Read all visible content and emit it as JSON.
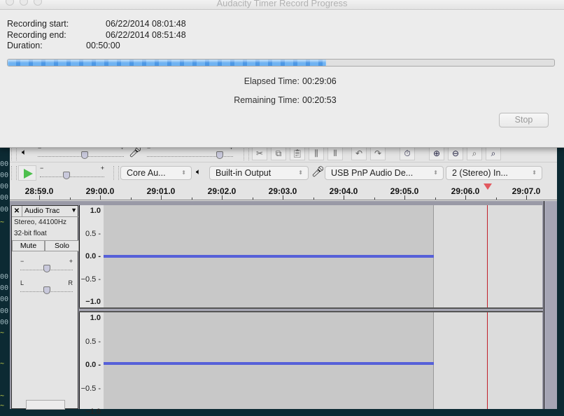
{
  "dialog": {
    "title": "Audacity Timer Record Progress",
    "recording_start_label": "Recording start:",
    "recording_start_value": "06/22/2014 08:01:48",
    "recording_end_label": "Recording end:",
    "recording_end_value": "06/22/2014 08:51:48",
    "duration_label": "Duration:",
    "duration_value": "00:50:00",
    "progress_percent": 58.2,
    "elapsed_label": "Elapsed Time:",
    "elapsed_value": "00:29:06",
    "remaining_label": "Remaining Time:",
    "remaining_value": "00:20:53",
    "stop_label": "Stop"
  },
  "toolbar": {
    "playback_volume_level": 0.55,
    "record_volume_level": 0.88,
    "play_speed_level": 0.4,
    "host_combo": "Core Au...",
    "output_combo": "Built-in Output",
    "input_combo": "USB PnP Audio De...",
    "channels_combo": "2 (Stereo) In...",
    "edit_buttons": [
      "trim-audio",
      "silence-audio",
      "cut",
      "copy",
      "paste",
      "undo",
      "redo",
      "sync-lock",
      "zoom-in",
      "zoom-out",
      "fit-selection",
      "fit-project"
    ],
    "minus": "−",
    "plus": "+"
  },
  "ruler": {
    "labels": [
      "28:59.0",
      "29:00.0",
      "29:01.0",
      "29:02.0",
      "29:03.0",
      "29:04.0",
      "29:05.0",
      "29:06.0",
      "29:07.0"
    ],
    "playhead_marker": "29:06.4"
  },
  "track": {
    "name": "Audio Trac",
    "format": "Stereo, 44100Hz",
    "bit_depth": "32-bit float",
    "mute_label": "Mute",
    "solo_label": "Solo",
    "gain_minus": "−",
    "gain_plus": "+",
    "pan_left": "L",
    "pan_right": "R",
    "gain_level": 0.5,
    "pan_level": 0.5,
    "scale_labels": [
      "1.0",
      "0.5",
      "0.0",
      "−0.5",
      "−1.0"
    ]
  },
  "terminal": {
    "lines": [
      "00",
      "00",
      "00",
      "00",
      "00",
      "~",
      "00",
      "00",
      "00",
      "00",
      "00",
      "~",
      "~",
      "~",
      "~"
    ]
  }
}
